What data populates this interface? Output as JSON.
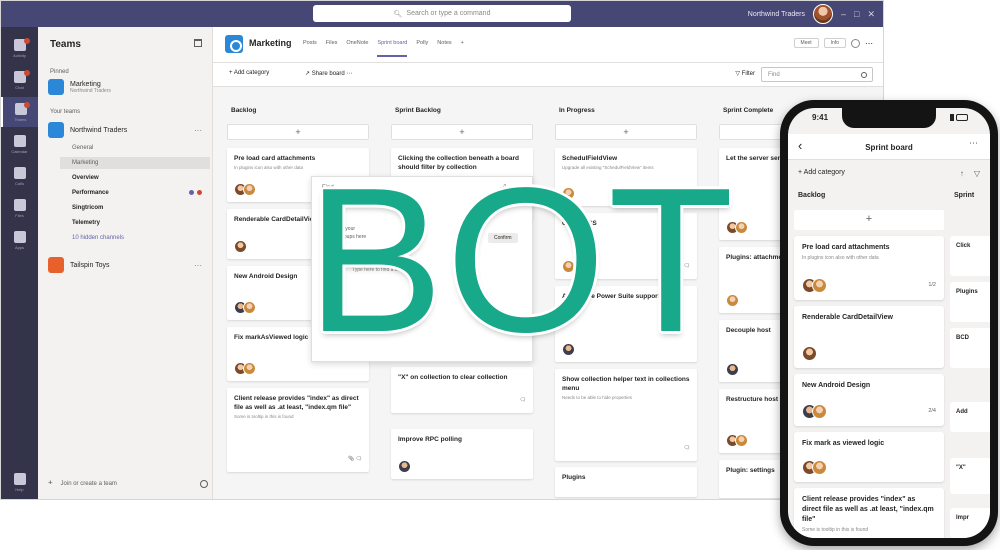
{
  "search": {
    "placeholder": "Search or type a command"
  },
  "user": {
    "org": "Northwind Traders"
  },
  "rail": [
    "Activity",
    "Chat",
    "Teams",
    "Calendar",
    "Calls",
    "Files",
    "Apps",
    "Help"
  ],
  "teams_panel": {
    "title": "Teams",
    "pinned_label": "Pinned",
    "your_teams_label": "Your teams",
    "pinned_team": {
      "name": "Marketing",
      "sub": "Northwind Traders"
    },
    "team1": {
      "name": "Northwind Traders"
    },
    "channels": [
      "General",
      "Marketing",
      "Overview",
      "Performance",
      "Singtricom",
      "Telemetry",
      "10 hidden channels"
    ],
    "team2": {
      "name": "Tailspin Toys"
    },
    "footer": "Join or create a team"
  },
  "channel": {
    "name": "Marketing",
    "tabs": [
      "Posts",
      "Files",
      "OneNote",
      "Sprint board",
      "Polly",
      "Notes",
      "+"
    ],
    "header_pills": [
      "Meet",
      "Info"
    ]
  },
  "toolbar": {
    "add_category": "Add category",
    "share": "Share board",
    "filter": "Filter",
    "find": "Find"
  },
  "columns": [
    {
      "title": "Backlog",
      "cards": [
        {
          "title": "Pre load card attachments",
          "sub": "In plugins icon also with other data"
        },
        {
          "title": "Renderable CardDetailView",
          "sub": ""
        },
        {
          "title": "New Android Design",
          "sub": ""
        },
        {
          "title": "Fix markAsViewed logic",
          "sub": ""
        },
        {
          "title": "Client release provides \"index\" as direct file as well as .at least, \"index.qm file\"",
          "sub": "Some is tooltip in this is found"
        }
      ]
    },
    {
      "title": "Sprint Backlog",
      "cards": [
        {
          "title": "Clicking the collection beneath a board should filter by collection",
          "sub": ""
        },
        {
          "title": "\"X\" on collection to clear collection",
          "sub": ""
        },
        {
          "title": "Improve RPC polling",
          "sub": ""
        }
      ]
    },
    {
      "title": "In Progress",
      "cards": [
        {
          "title": "SchedulFieldView",
          "sub": "Upgrade all existing \"SchedulFieldView\" items"
        },
        {
          "title": "Check CSS",
          "sub": ""
        },
        {
          "title": "Add Office Power Suite support",
          "sub": ""
        },
        {
          "title": "Show collection helper text in collections menu",
          "sub": "Needs to be able to hide properties"
        },
        {
          "title": "Plugins",
          "sub": ""
        }
      ]
    },
    {
      "title": "Sprint Complete",
      "cards": [
        {
          "title": "Let the server send notification with URL",
          "sub": ""
        },
        {
          "title": "Plugins: attachments",
          "sub": ""
        },
        {
          "title": "Decouple host",
          "sub": ""
        },
        {
          "title": "Restructure host",
          "sub": ""
        },
        {
          "title": "Plugin: settings",
          "sub": ""
        }
      ]
    }
  ],
  "dialog": {
    "title": "Find",
    "line1": "Select your",
    "line2": "find groups here",
    "button": "Confirm",
    "line3": "Type here to find a board"
  },
  "logo": {
    "text": "BOT",
    "color": "#18a88a"
  },
  "phone": {
    "time": "9:41",
    "title": "Sprint board",
    "add_category": "Add category",
    "col1": "Backlog",
    "col2": "Sprint",
    "cards": [
      {
        "title": "Pre load card attachments",
        "sub": "In plugins icon also with other data",
        "counts": "1/2"
      },
      {
        "title": "Renderable CardDetailView",
        "sub": "",
        "counts": ""
      },
      {
        "title": "New Android Design",
        "sub": "",
        "counts": "2/4"
      },
      {
        "title": "Fix mark as viewed logic",
        "sub": "",
        "counts": ""
      },
      {
        "title": "Client release provides \"index\" as direct file as well as .at least, \"index.qm file\"",
        "sub": "Some is tooltip in this is found",
        "counts": ""
      }
    ],
    "peek": [
      "Click",
      "Plugins",
      "BCD",
      "Add",
      "\"X\"",
      "Impr"
    ]
  }
}
